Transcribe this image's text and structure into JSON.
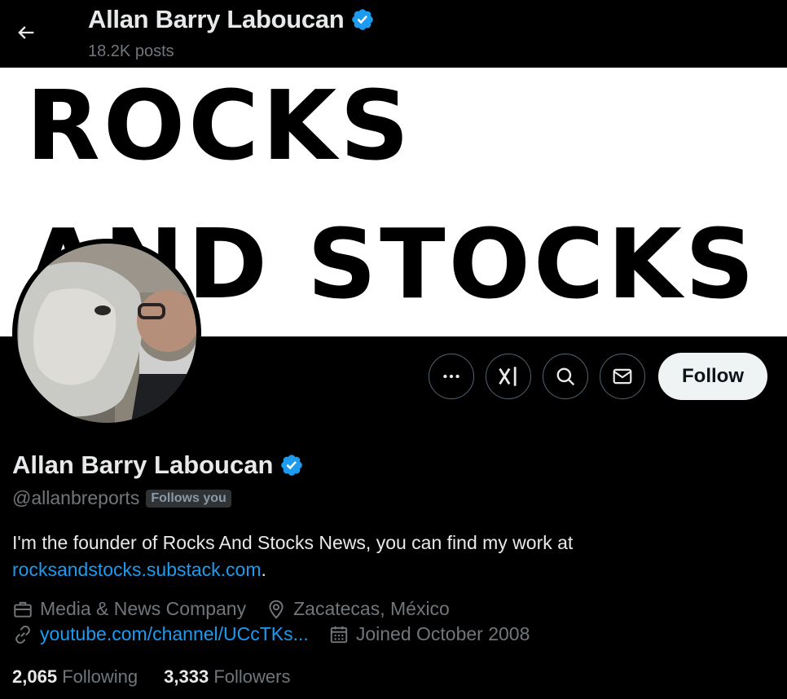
{
  "header": {
    "name": "Allan Barry Laboucan",
    "posts": "18.2K posts"
  },
  "banner": {
    "line1": "ROCKS",
    "line2": "AND STOCKS"
  },
  "actions": {
    "follow_label": "Follow"
  },
  "profile": {
    "name": "Allan Barry Laboucan",
    "handle": "@allanbreports",
    "follows_you": "Follows you",
    "bio_text": "I'm the founder of Rocks And Stocks News, you can find my work at ",
    "bio_link": "rocksandstocks.substack.com",
    "bio_end": ".",
    "category": "Media & News Company",
    "location": "Zacatecas, México",
    "website": "youtube.com/channel/UCcTKs...",
    "joined": "Joined October 2008"
  },
  "stats": {
    "following_count": "2,065",
    "following_label": "Following",
    "followers_count": "3,333",
    "followers_label": "Followers"
  },
  "colors": {
    "accent": "#1d9bf0",
    "background": "#000000",
    "secondary_text": "#71767b"
  }
}
